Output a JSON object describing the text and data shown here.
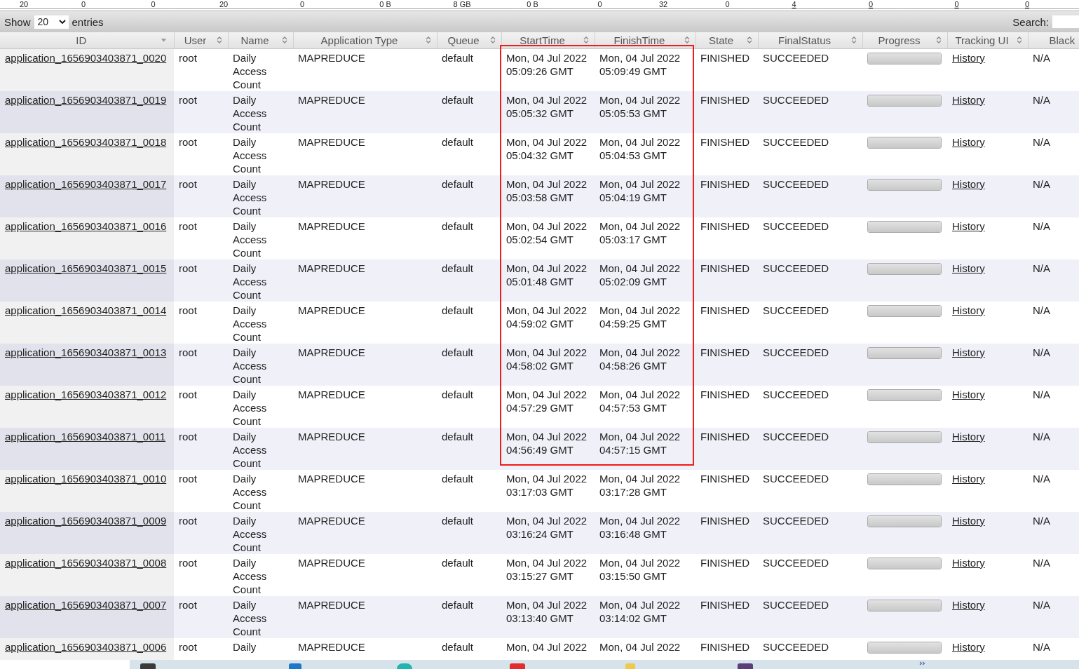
{
  "cluster_metrics": [
    {
      "text": "20",
      "link": false
    },
    {
      "text": "0",
      "link": false
    },
    {
      "text": "0",
      "link": false
    },
    {
      "text": "20",
      "link": false
    },
    {
      "text": "0",
      "link": false
    },
    {
      "text": "0 B",
      "link": false
    },
    {
      "text": "8 GB",
      "link": false
    },
    {
      "text": "0 B",
      "link": false
    },
    {
      "text": "0",
      "link": false
    },
    {
      "text": "32",
      "link": false
    },
    {
      "text": "0",
      "link": false
    },
    {
      "text": "4",
      "link": true
    },
    {
      "text": "0",
      "link": true
    },
    {
      "text": "0",
      "link": true
    },
    {
      "text": "0",
      "link": true
    }
  ],
  "toolbar": {
    "show_label": "Show",
    "page_size": "20",
    "entries_label": "entries",
    "search_label": "Search:"
  },
  "table": {
    "columns": [
      {
        "label": "ID",
        "sorted": true
      },
      {
        "label": "User",
        "sorted": false
      },
      {
        "label": "Name",
        "sorted": false
      },
      {
        "label": "Application Type",
        "sorted": false
      },
      {
        "label": "Queue",
        "sorted": false
      },
      {
        "label": "StartTime",
        "sorted": false
      },
      {
        "label": "FinishTime",
        "sorted": false
      },
      {
        "label": "State",
        "sorted": false
      },
      {
        "label": "FinalStatus",
        "sorted": false
      },
      {
        "label": "Progress",
        "sorted": false
      },
      {
        "label": "Tracking UI",
        "sorted": false
      },
      {
        "label": "Black"
      }
    ],
    "rows": [
      {
        "id": "application_1656903403871_0020",
        "user": "root",
        "name": "Daily Access Count",
        "type": "MAPREDUCE",
        "queue": "default",
        "start": "Mon, 04 Jul 2022 05:09:26 GMT",
        "finish": "Mon, 04 Jul 2022 05:09:49 GMT",
        "state": "FINISHED",
        "final_status": "SUCCEEDED",
        "progress": {
          "level": 1
        },
        "tracking": "History",
        "blacklisted": "N/A",
        "highlighted": true
      },
      {
        "id": "application_1656903403871_0019",
        "user": "root",
        "name": "Daily Access Count",
        "type": "MAPREDUCE",
        "queue": "default",
        "start": "Mon, 04 Jul 2022 05:05:32 GMT",
        "finish": "Mon, 04 Jul 2022 05:05:53 GMT",
        "state": "FINISHED",
        "final_status": "SUCCEEDED",
        "progress": {
          "level": 1
        },
        "tracking": "History",
        "blacklisted": "N/A",
        "highlighted": true
      },
      {
        "id": "application_1656903403871_0018",
        "user": "root",
        "name": "Daily Access Count",
        "type": "MAPREDUCE",
        "queue": "default",
        "start": "Mon, 04 Jul 2022 05:04:32 GMT",
        "finish": "Mon, 04 Jul 2022 05:04:53 GMT",
        "state": "FINISHED",
        "final_status": "SUCCEEDED",
        "progress": {
          "level": 1
        },
        "tracking": "History",
        "blacklisted": "N/A",
        "highlighted": true
      },
      {
        "id": "application_1656903403871_0017",
        "user": "root",
        "name": "Daily Access Count",
        "type": "MAPREDUCE",
        "queue": "default",
        "start": "Mon, 04 Jul 2022 05:03:58 GMT",
        "finish": "Mon, 04 Jul 2022 05:04:19 GMT",
        "state": "FINISHED",
        "final_status": "SUCCEEDED",
        "progress": {
          "level": 1
        },
        "tracking": "History",
        "blacklisted": "N/A",
        "highlighted": true
      },
      {
        "id": "application_1656903403871_0016",
        "user": "root",
        "name": "Daily Access Count",
        "type": "MAPREDUCE",
        "queue": "default",
        "start": "Mon, 04 Jul 2022 05:02:54 GMT",
        "finish": "Mon, 04 Jul 2022 05:03:17 GMT",
        "state": "FINISHED",
        "final_status": "SUCCEEDED",
        "progress": {
          "level": 1
        },
        "tracking": "History",
        "blacklisted": "N/A",
        "highlighted": true
      },
      {
        "id": "application_1656903403871_0015",
        "user": "root",
        "name": "Daily Access Count",
        "type": "MAPREDUCE",
        "queue": "default",
        "start": "Mon, 04 Jul 2022 05:01:48 GMT",
        "finish": "Mon, 04 Jul 2022 05:02:09 GMT",
        "state": "FINISHED",
        "final_status": "SUCCEEDED",
        "progress": {
          "level": 1
        },
        "tracking": "History",
        "blacklisted": "N/A",
        "highlighted": true
      },
      {
        "id": "application_1656903403871_0014",
        "user": "root",
        "name": "Daily Access Count",
        "type": "MAPREDUCE",
        "queue": "default",
        "start": "Mon, 04 Jul 2022 04:59:02 GMT",
        "finish": "Mon, 04 Jul 2022 04:59:25 GMT",
        "state": "FINISHED",
        "final_status": "SUCCEEDED",
        "progress": {
          "level": 1
        },
        "tracking": "History",
        "blacklisted": "N/A",
        "highlighted": true
      },
      {
        "id": "application_1656903403871_0013",
        "user": "root",
        "name": "Daily Access Count",
        "type": "MAPREDUCE",
        "queue": "default",
        "start": "Mon, 04 Jul 2022 04:58:02 GMT",
        "finish": "Mon, 04 Jul 2022 04:58:26 GMT",
        "state": "FINISHED",
        "final_status": "SUCCEEDED",
        "progress": {
          "level": 1
        },
        "tracking": "History",
        "blacklisted": "N/A",
        "highlighted": true
      },
      {
        "id": "application_1656903403871_0012",
        "user": "root",
        "name": "Daily Access Count",
        "type": "MAPREDUCE",
        "queue": "default",
        "start": "Mon, 04 Jul 2022 04:57:29 GMT",
        "finish": "Mon, 04 Jul 2022 04:57:53 GMT",
        "state": "FINISHED",
        "final_status": "SUCCEEDED",
        "progress": {
          "level": 1
        },
        "tracking": "History",
        "blacklisted": "N/A",
        "highlighted": true
      },
      {
        "id": "application_1656903403871_0011",
        "user": "root",
        "name": "Daily Access Count",
        "type": "MAPREDUCE",
        "queue": "default",
        "start": "Mon, 04 Jul 2022 04:56:49 GMT",
        "finish": "Mon, 04 Jul 2022 04:57:15 GMT",
        "state": "FINISHED",
        "final_status": "SUCCEEDED",
        "progress": {
          "level": 1
        },
        "tracking": "History",
        "blacklisted": "N/A",
        "highlighted": true
      },
      {
        "id": "application_1656903403871_0010",
        "user": "root",
        "name": "Daily Access Count",
        "type": "MAPREDUCE",
        "queue": "default",
        "start": "Mon, 04 Jul 2022 03:17:03 GMT",
        "finish": "Mon, 04 Jul 2022 03:17:28 GMT",
        "state": "FINISHED",
        "final_status": "SUCCEEDED",
        "progress": {
          "level": 1
        },
        "tracking": "History",
        "blacklisted": "N/A",
        "highlighted": false
      },
      {
        "id": "application_1656903403871_0009",
        "user": "root",
        "name": "Daily Access Count",
        "type": "MAPREDUCE",
        "queue": "default",
        "start": "Mon, 04 Jul 2022 03:16:24 GMT",
        "finish": "Mon, 04 Jul 2022 03:16:48 GMT",
        "state": "FINISHED",
        "final_status": "SUCCEEDED",
        "progress": {
          "level": 1
        },
        "tracking": "History",
        "blacklisted": "N/A",
        "highlighted": false
      },
      {
        "id": "application_1656903403871_0008",
        "user": "root",
        "name": "Daily Access Count",
        "type": "MAPREDUCE",
        "queue": "default",
        "start": "Mon, 04 Jul 2022 03:15:27 GMT",
        "finish": "Mon, 04 Jul 2022 03:15:50 GMT",
        "state": "FINISHED",
        "final_status": "SUCCEEDED",
        "progress": {
          "level": 1
        },
        "tracking": "History",
        "blacklisted": "N/A",
        "highlighted": false
      },
      {
        "id": "application_1656903403871_0007",
        "user": "root",
        "name": "Daily Access Count",
        "type": "MAPREDUCE",
        "queue": "default",
        "start": "Mon, 04 Jul 2022 03:13:40 GMT",
        "finish": "Mon, 04 Jul 2022 03:14:02 GMT",
        "state": "FINISHED",
        "final_status": "SUCCEEDED",
        "progress": {
          "level": 1
        },
        "tracking": "History",
        "blacklisted": "N/A",
        "highlighted": false
      },
      {
        "id": "application_1656903403871_0006",
        "user": "root",
        "name": "Daily",
        "type": "MAPREDUCE",
        "queue": "default",
        "start": "Mon, 04 Jul 2022",
        "finish": "Mon, 04 Jul 2022",
        "state": "FINISHED",
        "final_status": "SUCCEEDED",
        "progress": {
          "level": 1
        },
        "tracking": "History",
        "blacklisted": "N/A",
        "highlighted": false
      }
    ]
  }
}
